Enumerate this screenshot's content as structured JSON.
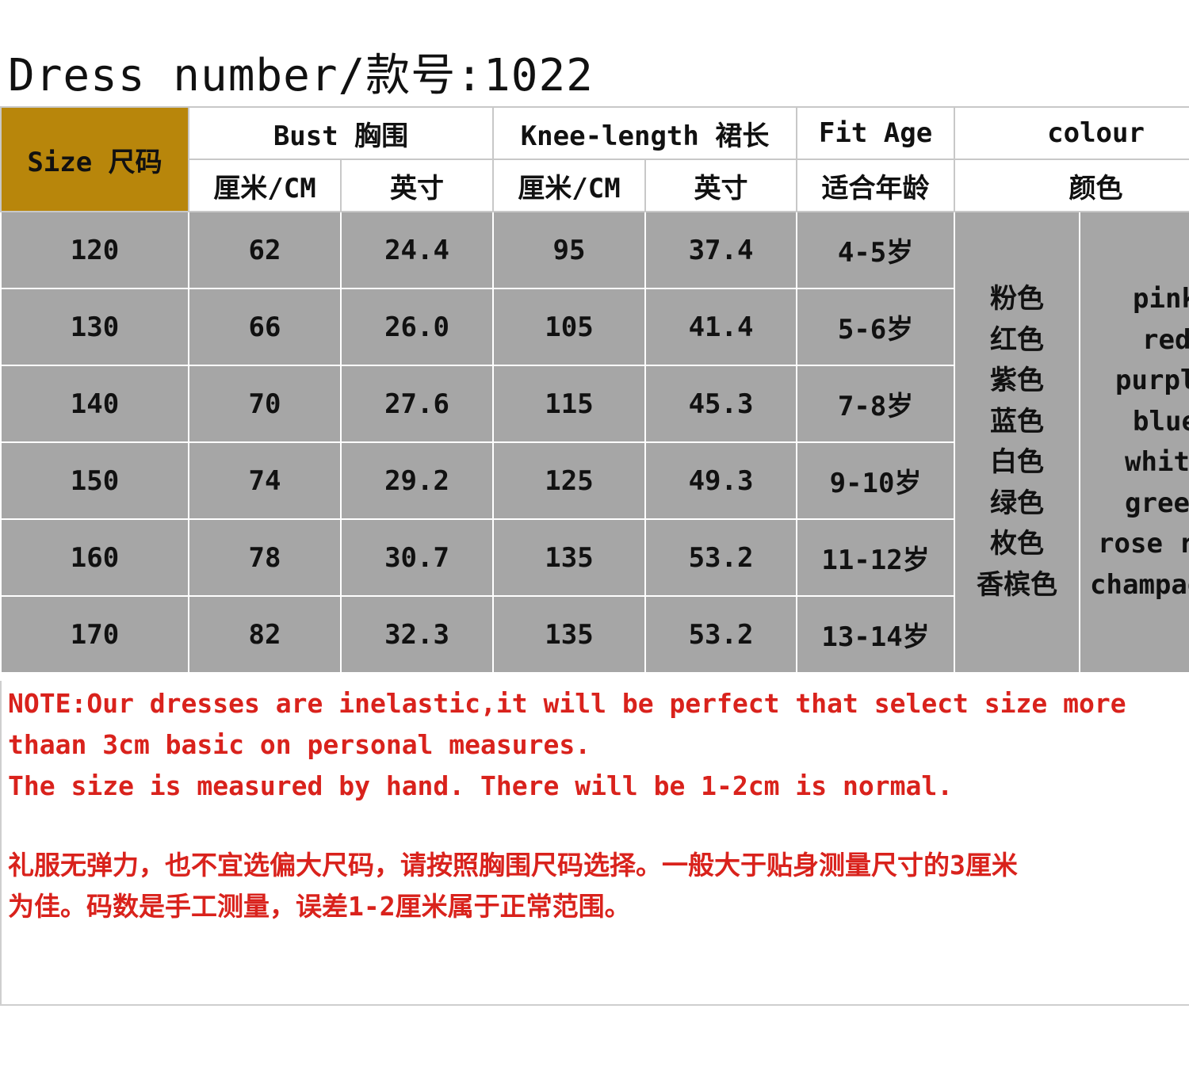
{
  "title": "Dress number/款号:1022",
  "header": {
    "size": "Size 尺码",
    "bust": "Bust 胸围",
    "knee_length": "Knee-length  裙长",
    "fit_age": "Fit Age",
    "colour": "colour",
    "cm": "厘米/CM",
    "inch": "英寸",
    "fit_age_cn": "适合年龄",
    "colour_cn": "颜色"
  },
  "rows": [
    {
      "size": "120",
      "bust_cm": "62",
      "bust_in": "24.4",
      "len_cm": "95",
      "len_in": "37.4",
      "age": "4-5岁"
    },
    {
      "size": "130",
      "bust_cm": "66",
      "bust_in": "26.0",
      "len_cm": "105",
      "len_in": "41.4",
      "age": "5-6岁"
    },
    {
      "size": "140",
      "bust_cm": "70",
      "bust_in": "27.6",
      "len_cm": "115",
      "len_in": "45.3",
      "age": "7-8岁"
    },
    {
      "size": "150",
      "bust_cm": "74",
      "bust_in": "29.2",
      "len_cm": "125",
      "len_in": "49.3",
      "age": "9-10岁"
    },
    {
      "size": "160",
      "bust_cm": "78",
      "bust_in": "30.7",
      "len_cm": "135",
      "len_in": "53.2",
      "age": "11-12岁"
    },
    {
      "size": "170",
      "bust_cm": "82",
      "bust_in": "32.3",
      "len_cm": "135",
      "len_in": "53.2",
      "age": "13-14岁"
    }
  ],
  "colours_cn": [
    "粉色",
    "红色",
    "紫色",
    "蓝色",
    "白色",
    "绿色",
    "枚色",
    "香槟色"
  ],
  "colours_en": [
    "pink",
    "red",
    "purple",
    "blue",
    "white",
    "green",
    "rose red",
    "champagne"
  ],
  "notes": {
    "line1": "NOTE:Our dresses are inelastic,it will be perfect that select size more",
    "line2": "thaan 3cm basic on personal measures.",
    "line3": "The size is measured by hand. There will be 1-2cm is normal.",
    "line4": "礼服无弹力，也不宜选偏大尺码，请按照胸围尺码选择。一般大于贴身测量尺寸的3厘米",
    "line5": "为佳。码数是手工测量，误差1-2厘米属于正常范围。"
  },
  "colors": {
    "header_accent": "#b8860b",
    "row_background": "#a6a6a6",
    "note_text": "#d9221c"
  }
}
